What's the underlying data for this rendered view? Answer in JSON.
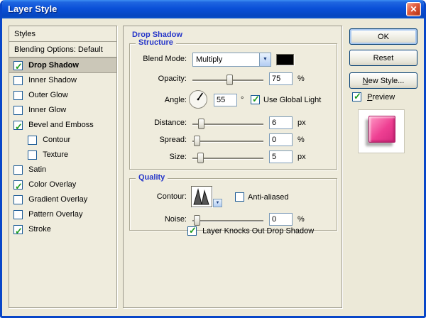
{
  "window": {
    "title": "Layer Style"
  },
  "icons": {
    "close": "✕",
    "chevron_down": "▼",
    "check": "✓"
  },
  "colors": {
    "dialog_bg": "#ECE9D8",
    "accent_blue": "#2636C9",
    "titlebar_blue": "#0A50D8",
    "selection_gray": "#CBC7B8",
    "check_green": "#1D9B1D",
    "preview_pink": "#EE3F92",
    "blend_swatch": "#000000"
  },
  "styles_panel": {
    "header": "Styles",
    "blending_options": "Blending Options: Default",
    "items": [
      {
        "label": "Drop Shadow",
        "checked": true,
        "selected": true
      },
      {
        "label": "Inner Shadow",
        "checked": false
      },
      {
        "label": "Outer Glow",
        "checked": false
      },
      {
        "label": "Inner Glow",
        "checked": false
      },
      {
        "label": "Bevel and Emboss",
        "checked": true
      },
      {
        "label": "Contour",
        "checked": false,
        "indented": true
      },
      {
        "label": "Texture",
        "checked": false,
        "indented": true
      },
      {
        "label": "Satin",
        "checked": false
      },
      {
        "label": "Color Overlay",
        "checked": true
      },
      {
        "label": "Gradient Overlay",
        "checked": false
      },
      {
        "label": "Pattern Overlay",
        "checked": false
      },
      {
        "label": "Stroke",
        "checked": true
      }
    ]
  },
  "main": {
    "title": "Drop Shadow",
    "structure": {
      "group_label": "Structure",
      "blend_mode_label": "Blend Mode:",
      "blend_mode_value": "Multiply",
      "opacity_label": "Opacity:",
      "opacity_value": "75",
      "opacity_unit": "%",
      "angle_label": "Angle:",
      "angle_value": "55",
      "angle_unit": "°",
      "use_global_light_label": "Use Global Light",
      "use_global_light_checked": true,
      "distance_label": "Distance:",
      "distance_value": "6",
      "distance_unit": "px",
      "spread_label": "Spread:",
      "spread_value": "0",
      "spread_unit": "%",
      "size_label": "Size:",
      "size_value": "5",
      "size_unit": "px"
    },
    "quality": {
      "group_label": "Quality",
      "contour_label": "Contour:",
      "anti_aliased_label": "Anti-aliased",
      "anti_aliased_checked": false,
      "noise_label": "Noise:",
      "noise_value": "0",
      "noise_unit": "%"
    },
    "knockout_label": "Layer Knocks Out Drop Shadow",
    "knockout_checked": true
  },
  "actions": {
    "ok": "OK",
    "reset": "Reset",
    "new_style": "New Style...",
    "preview_label": "Preview",
    "preview_checked": true
  }
}
